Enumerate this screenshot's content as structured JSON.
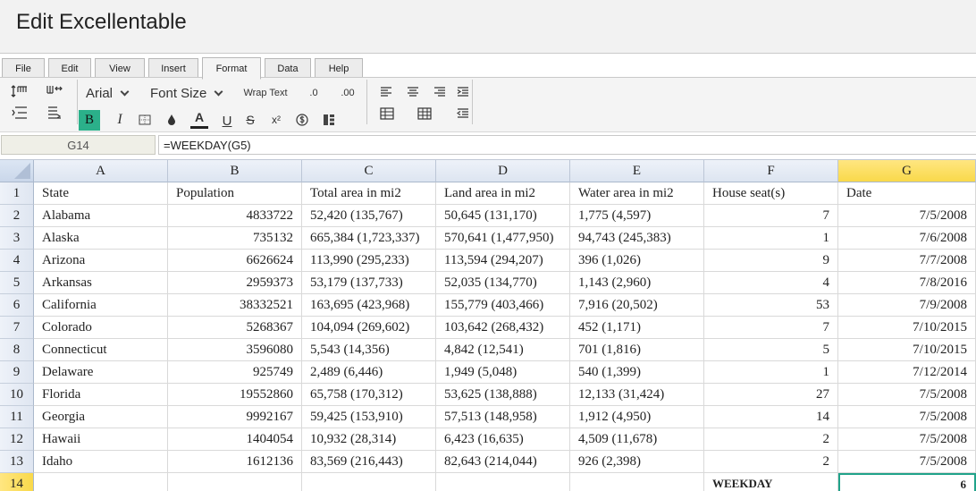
{
  "app": {
    "title": "Edit Excellentable"
  },
  "menu_tabs": [
    "File",
    "Edit",
    "View",
    "Insert",
    "Format",
    "Data",
    "Help"
  ],
  "active_tab": "Format",
  "toolbar": {
    "font_family": "Arial",
    "font_size_label": "Font Size",
    "wrap_text_label": "Wrap Text",
    "decrease_decimal_label": ".0",
    "increase_decimal_label": ".00",
    "bold_label": "B",
    "italic_label": "I",
    "font_color_label": "A",
    "underline_label": "U",
    "strikethrough_label": "S",
    "superscript_label": "x²",
    "bold_active_color": "#2bb08a"
  },
  "formula_bar": {
    "cell_ref": "G14",
    "formula": "=WEEKDAY(G5)"
  },
  "sheet": {
    "columns": [
      "A",
      "B",
      "C",
      "D",
      "E",
      "F",
      "G"
    ],
    "selected_column": "G",
    "row_numbers": [
      "1",
      "2",
      "3",
      "4",
      "5",
      "6",
      "7",
      "8",
      "9",
      "10",
      "11",
      "12",
      "13",
      "14"
    ],
    "selected_row": "14",
    "rows": [
      [
        "State",
        "Population",
        "Total area in mi2",
        "Land area in mi2",
        "Water area in mi2",
        "House seat(s)",
        "Date"
      ],
      [
        "Alabama",
        "4833722",
        "52,420 (135,767)",
        "50,645 (131,170)",
        "1,775 (4,597)",
        "7",
        "7/5/2008"
      ],
      [
        "Alaska",
        "735132",
        "665,384 (1,723,337)",
        "570,641 (1,477,950)",
        "94,743 (245,383)",
        "1",
        "7/6/2008"
      ],
      [
        "Arizona",
        "6626624",
        "113,990 (295,233)",
        "113,594 (294,207)",
        "396 (1,026)",
        "9",
        "7/7/2008"
      ],
      [
        "Arkansas",
        "2959373",
        "53,179 (137,733)",
        "52,035 (134,770)",
        "1,143 (2,960)",
        "4",
        "7/8/2016"
      ],
      [
        "California",
        "38332521",
        "163,695 (423,968)",
        "155,779 (403,466)",
        "7,916 (20,502)",
        "53",
        "7/9/2008"
      ],
      [
        "Colorado",
        "5268367",
        "104,094 (269,602)",
        "103,642 (268,432)",
        "452 (1,171)",
        "7",
        "7/10/2015"
      ],
      [
        "Connecticut",
        "3596080",
        "5,543 (14,356)",
        "4,842 (12,541)",
        "701 (1,816)",
        "5",
        "7/10/2015"
      ],
      [
        "Delaware",
        "925749",
        "2,489 (6,446)",
        "1,949 (5,048)",
        "540 (1,399)",
        "1",
        "7/12/2014"
      ],
      [
        "Florida",
        "19552860",
        "65,758 (170,312)",
        "53,625 (138,888)",
        "12,133 (31,424)",
        "27",
        "7/5/2008"
      ],
      [
        "Georgia",
        "9992167",
        "59,425 (153,910)",
        "57,513 (148,958)",
        "1,912 (4,950)",
        "14",
        "7/5/2008"
      ],
      [
        "Hawaii",
        "1404054",
        "10,932 (28,314)",
        "6,423 (16,635)",
        "4,509 (11,678)",
        "2",
        "7/5/2008"
      ],
      [
        "Idaho",
        "1612136",
        "83,569 (216,443)",
        "82,643 (214,044)",
        "926 (2,398)",
        "2",
        "7/5/2008"
      ],
      [
        "",
        "",
        "",
        "",
        "",
        "WEEKDAY",
        "6"
      ]
    ]
  },
  "colors": {
    "selection_header": "#f9d94a",
    "active_cell_border": "#21a38a"
  }
}
